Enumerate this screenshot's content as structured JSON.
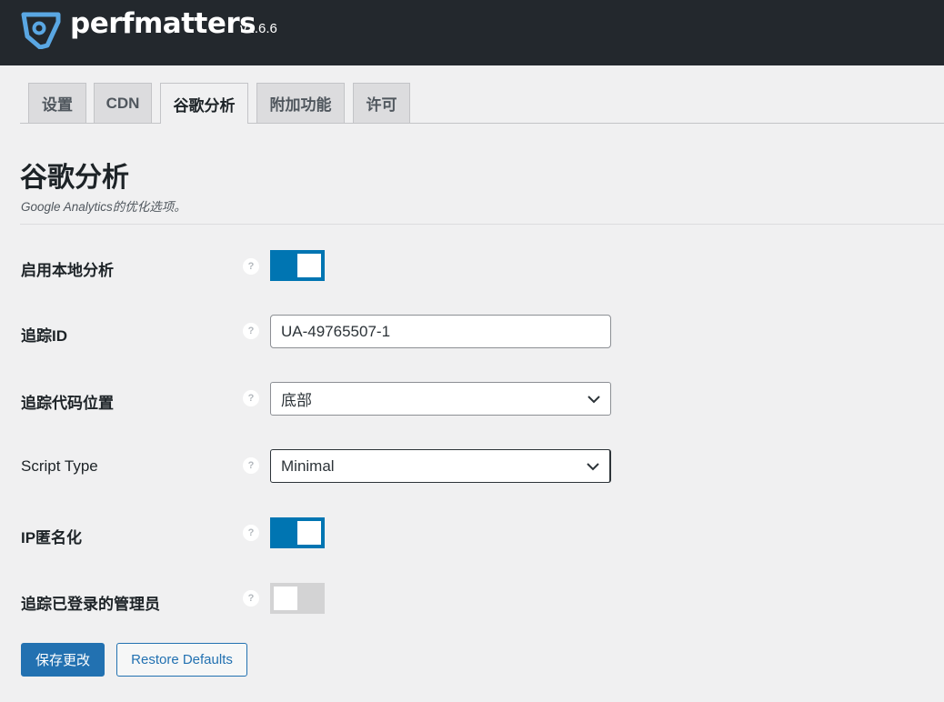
{
  "header": {
    "brand": "perfmatters",
    "version": "v1.6.6",
    "background_color": "#23282d",
    "logo_color": "#5aa7e3"
  },
  "tabs": [
    {
      "label": "设置",
      "active": false
    },
    {
      "label": "CDN",
      "active": false
    },
    {
      "label": "谷歌分析",
      "active": true
    },
    {
      "label": "附加功能",
      "active": false
    },
    {
      "label": "许可",
      "active": false
    }
  ],
  "page": {
    "title": "谷歌分析",
    "subtitle": "Google Analytics的优化选项。"
  },
  "settings": {
    "enable_local": {
      "label": "启用本地分析",
      "enabled": true
    },
    "tracking_id": {
      "label": "追踪ID",
      "value": "UA-49765507-1"
    },
    "tracking_position": {
      "label": "追踪代码位置",
      "selected": "底部"
    },
    "script_type": {
      "label": "Script Type",
      "selected": "Minimal"
    },
    "anonymize_ip": {
      "label": "IP匿名化",
      "enabled": true
    },
    "track_admins": {
      "label": "追踪已登录的管理员",
      "enabled": false
    }
  },
  "help_glyph": "?",
  "buttons": {
    "save": "保存更改",
    "restore": "Restore Defaults"
  },
  "colors": {
    "accent": "#2271b1",
    "toggle_on": "#0075b2",
    "toggle_off": "#d3d3d4"
  },
  "icons": [
    "perfmatters-logo-icon",
    "help-icon",
    "chevron-down-icon"
  ]
}
